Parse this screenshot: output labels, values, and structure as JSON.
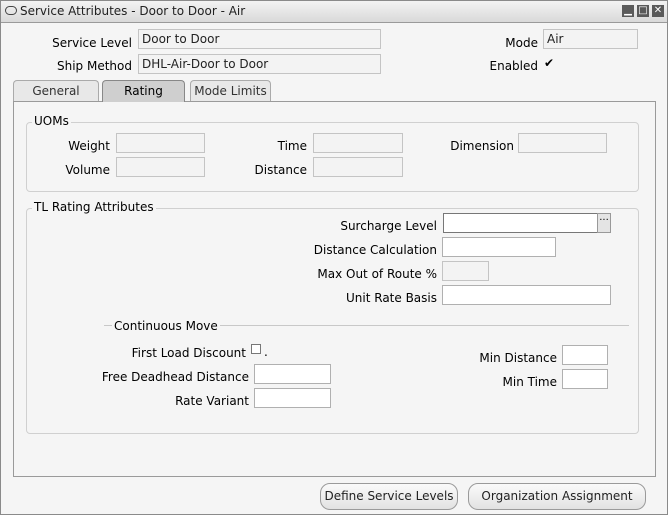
{
  "window": {
    "title": "Service Attributes - Door to Door - Air"
  },
  "header": {
    "service_level_label": "Service Level",
    "service_level_value": "Door to Door",
    "ship_method_label": "Ship Method",
    "ship_method_value": "DHL-Air-Door to Door",
    "mode_label": "Mode",
    "mode_value": "Air",
    "enabled_label": "Enabled",
    "enabled_checked": true
  },
  "tabs": [
    {
      "label": "General"
    },
    {
      "label": "Rating"
    },
    {
      "label": "Mode Limits"
    }
  ],
  "uoms": {
    "title": "UOMs",
    "weight_label": "Weight",
    "time_label": "Time",
    "dimension_label": "Dimension",
    "volume_label": "Volume",
    "distance_label": "Distance"
  },
  "tl_rating": {
    "title": "TL Rating Attributes",
    "surcharge_level_label": "Surcharge Level",
    "distance_calculation_label": "Distance Calculation",
    "max_out_of_route_label": "Max Out of Route %",
    "unit_rate_basis_label": "Unit Rate Basis",
    "continuous_move_title": "Continuous Move",
    "first_load_discount_label": "First Load Discount",
    "first_load_discount_suffix": ".",
    "free_deadhead_label": "Free Deadhead Distance",
    "rate_variant_label": "Rate Variant",
    "min_distance_label": "Min Distance",
    "min_time_label": "Min Time"
  },
  "buttons": {
    "define_service_levels": "Define Service Levels",
    "organization_assignment": "Organization Assignment"
  }
}
